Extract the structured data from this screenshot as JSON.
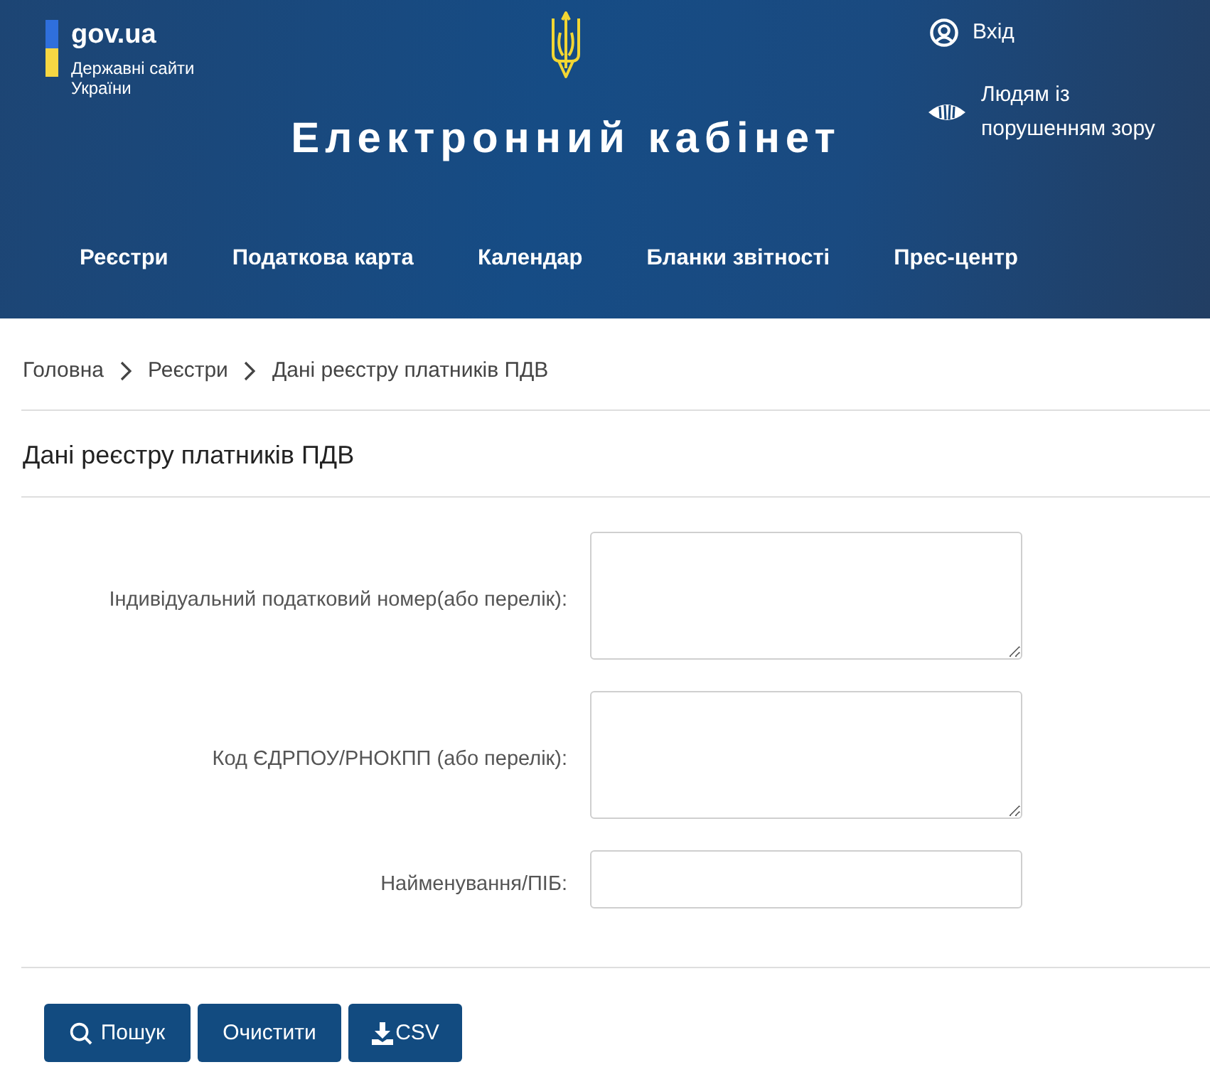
{
  "header": {
    "logo": {
      "name": "gov.ua",
      "tagline": "Державні сайти України"
    },
    "title": "Електронний кабінет",
    "links": [
      {
        "kind": "login",
        "label": "Вхід"
      },
      {
        "kind": "accessibility",
        "label": "Людям із порушенням зору"
      }
    ]
  },
  "nav": {
    "items": [
      {
        "label": "Реєстри",
        "selected": false
      },
      {
        "label": "Податкова карта",
        "selected": false
      },
      {
        "label": "Календар",
        "selected": false
      },
      {
        "label": "Бланки звітності",
        "selected": false
      },
      {
        "label": "Прес-центр",
        "selected": false
      }
    ]
  },
  "breadcrumb": [
    "Головна",
    "Реєстри",
    "Дані реєстру платників ПДВ"
  ],
  "page_title": "Дані реєстру платників ПДВ",
  "form": {
    "fields": [
      {
        "kind": "textarea",
        "label": "Індивідуальний податковий номер(або перелік):"
      },
      {
        "kind": "textarea",
        "label": "Код ЄДРПОУ/РНОКПП (або перелік):"
      },
      {
        "kind": "input",
        "label": "Найменування/ПІБ:"
      }
    ]
  },
  "buttons": [
    {
      "kind": "search",
      "label": "Пошук"
    },
    {
      "kind": "clear",
      "label": "Очистити"
    },
    {
      "kind": "export",
      "label": "CSV"
    }
  ]
}
